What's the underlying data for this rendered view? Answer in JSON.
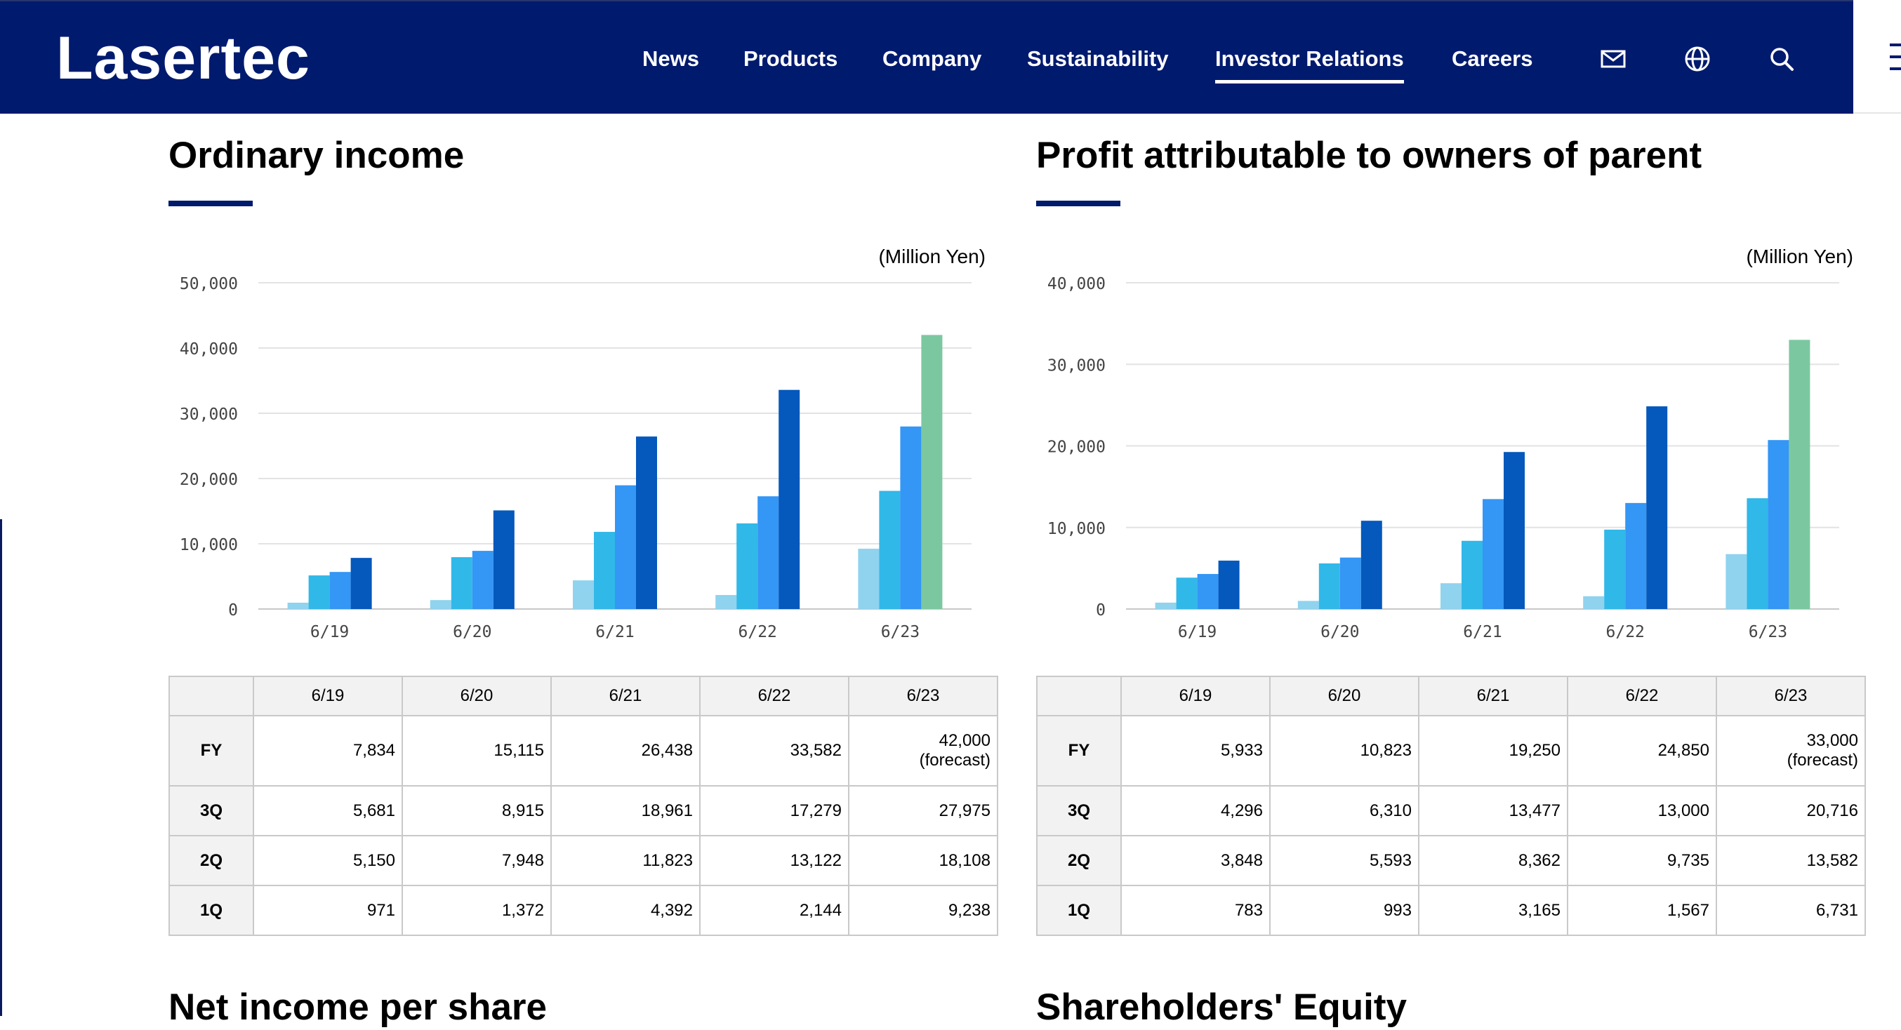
{
  "header": {
    "logo": "Lasertec",
    "nav": [
      {
        "label": "News"
      },
      {
        "label": "Products"
      },
      {
        "label": "Company"
      },
      {
        "label": "Sustainability"
      },
      {
        "label": "Investor Relations",
        "active": true
      },
      {
        "label": "Careers"
      }
    ],
    "icons": [
      "mail-icon",
      "globe-icon",
      "search-icon",
      "menu-icon"
    ]
  },
  "colors": {
    "header_bg": "#001a6e",
    "q1": "#8fd3ee",
    "q2": "#30b8e8",
    "q3": "#3496f5",
    "fy": "#0558bc",
    "forecast": "#7bc8a0"
  },
  "sections": [
    {
      "title": "Ordinary income"
    },
    {
      "title": "Profit attributable to owners of parent"
    }
  ],
  "tables": [
    {
      "columns": [
        "6/19",
        "6/20",
        "6/21",
        "6/22",
        "6/23"
      ],
      "rows": [
        {
          "label": "FY",
          "values": [
            "7,834",
            "15,115",
            "26,438",
            "33,582",
            "42,000"
          ],
          "note": "(forecast)"
        },
        {
          "label": "3Q",
          "values": [
            "5,681",
            "8,915",
            "18,961",
            "17,279",
            "27,975"
          ]
        },
        {
          "label": "2Q",
          "values": [
            "5,150",
            "7,948",
            "11,823",
            "13,122",
            "18,108"
          ]
        },
        {
          "label": "1Q",
          "values": [
            "971",
            "1,372",
            "4,392",
            "2,144",
            "9,238"
          ]
        }
      ]
    },
    {
      "columns": [
        "6/19",
        "6/20",
        "6/21",
        "6/22",
        "6/23"
      ],
      "rows": [
        {
          "label": "FY",
          "values": [
            "5,933",
            "10,823",
            "19,250",
            "24,850",
            "33,000"
          ],
          "note": "(forecast)"
        },
        {
          "label": "3Q",
          "values": [
            "4,296",
            "6,310",
            "13,477",
            "13,000",
            "20,716"
          ]
        },
        {
          "label": "2Q",
          "values": [
            "3,848",
            "5,593",
            "8,362",
            "9,735",
            "13,582"
          ]
        },
        {
          "label": "1Q",
          "values": [
            "783",
            "993",
            "3,165",
            "1,567",
            "6,731"
          ]
        }
      ]
    }
  ],
  "bottom_titles": [
    "Net income per share",
    "Shareholders' Equity"
  ],
  "chart_data": [
    {
      "type": "bar",
      "unit_label": "(Million Yen)",
      "categories": [
        "6/19",
        "6/20",
        "6/21",
        "6/22",
        "6/23"
      ],
      "ylim": [
        0,
        50000
      ],
      "yticks": [
        "0",
        "10,000",
        "20,000",
        "30,000",
        "40,000",
        "50,000"
      ],
      "grid": true,
      "series": [
        {
          "key": "q1",
          "values": [
            971,
            1372,
            4392,
            2144,
            9238
          ]
        },
        {
          "key": "q2",
          "values": [
            5150,
            7948,
            11823,
            13122,
            18108
          ]
        },
        {
          "key": "q3",
          "values": [
            5681,
            8915,
            18961,
            17279,
            27975
          ]
        },
        {
          "key": "fy",
          "values": [
            7834,
            15115,
            26438,
            33582,
            42000
          ],
          "forecast_index": 4
        }
      ]
    },
    {
      "type": "bar",
      "unit_label": "(Million Yen)",
      "categories": [
        "6/19",
        "6/20",
        "6/21",
        "6/22",
        "6/23"
      ],
      "ylim": [
        0,
        40000
      ],
      "yticks": [
        "0",
        "10,000",
        "20,000",
        "30,000",
        "40,000"
      ],
      "grid": true,
      "series": [
        {
          "key": "q1",
          "values": [
            783,
            993,
            3165,
            1567,
            6731
          ]
        },
        {
          "key": "q2",
          "values": [
            3848,
            5593,
            8362,
            9735,
            13582
          ]
        },
        {
          "key": "q3",
          "values": [
            4296,
            6310,
            13477,
            13000,
            20716
          ]
        },
        {
          "key": "fy",
          "values": [
            5933,
            10823,
            19250,
            24850,
            33000
          ],
          "forecast_index": 4
        }
      ]
    }
  ]
}
